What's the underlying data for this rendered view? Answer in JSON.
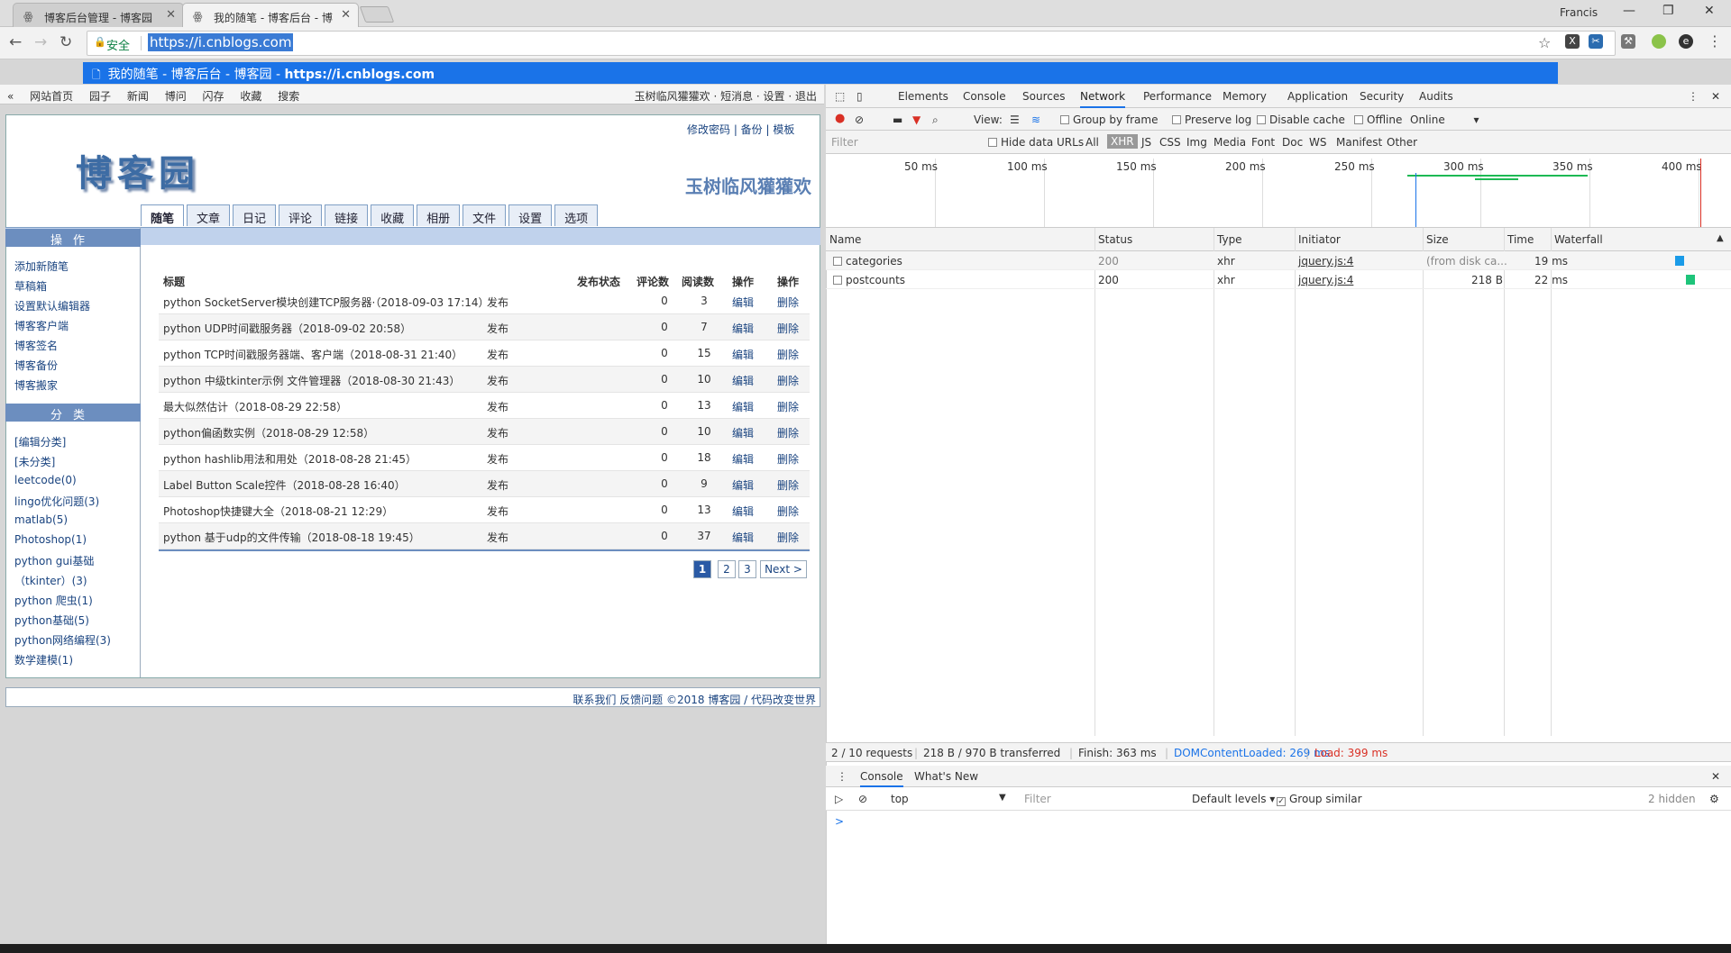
{
  "browser": {
    "tabs": [
      {
        "title": "博客后台管理 - 博客园"
      },
      {
        "title": "我的随笔 - 博客后台 - 博"
      }
    ],
    "user": "Francis",
    "secure_label": "安全",
    "url": "https://i.cnblogs.com",
    "suggestion": {
      "text": "我的随笔 - 博客后台 - 博客园 - ",
      "url": "https://i.cnblogs.com"
    }
  },
  "site": {
    "topnav": [
      "网站首页",
      "园子",
      "新闻",
      "博问",
      "闪存",
      "收藏",
      "搜索"
    ],
    "topnav_right": "玉树临风獾獾欢 · 短消息 · 设置 · 退出",
    "toplinks": "修改密码  |  备份  |  模板",
    "logo": "博客园",
    "blog_name": "玉树临风獾獾欢",
    "tabs": [
      "随笔",
      "文章",
      "日记",
      "评论",
      "链接",
      "收藏",
      "相册",
      "文件",
      "设置",
      "选项"
    ],
    "ops_title": "操作",
    "ops": [
      "添加新随笔",
      "草稿箱",
      "设置默认编辑器",
      "博客客户端",
      "博客签名",
      "博客备份",
      "博客搬家"
    ],
    "cat_title": "分类",
    "categories": [
      "[编辑分类]",
      "[未分类]",
      "leetcode(0)",
      "lingo优化问题(3)",
      "matlab(5)",
      "Photoshop(1)",
      "python gui基础",
      "（tkinter）(3)",
      "python 爬虫(1)",
      "python基础(5)",
      "python网络编程(3)",
      "数学建模(1)"
    ],
    "table": {
      "headers": {
        "title": "标题",
        "status": "发布状态",
        "comments": "评论数",
        "reads": "阅读数",
        "op1": "操作",
        "op2": "操作"
      },
      "rows": [
        {
          "title": "python SocketServer模块创建TCP服务器·（2018-09-03 17:14）",
          "status": "发布",
          "comments": "0",
          "reads": "3",
          "edit": "编辑",
          "del": "删除"
        },
        {
          "title": "python UDP时间戳服务器（2018-09-02 20:58）",
          "status": "发布",
          "comments": "0",
          "reads": "7",
          "edit": "编辑",
          "del": "删除"
        },
        {
          "title": "python TCP时间戳服务器端、客户端（2018-08-31 21:40）",
          "status": "发布",
          "comments": "0",
          "reads": "15",
          "edit": "编辑",
          "del": "删除"
        },
        {
          "title": "python 中级tkinter示例 文件管理器（2018-08-30 21:43）",
          "status": "发布",
          "comments": "0",
          "reads": "10",
          "edit": "编辑",
          "del": "删除"
        },
        {
          "title": "最大似然估计（2018-08-29 22:58）",
          "status": "发布",
          "comments": "0",
          "reads": "13",
          "edit": "编辑",
          "del": "删除"
        },
        {
          "title": "python偏函数实例（2018-08-29 12:58）",
          "status": "发布",
          "comments": "0",
          "reads": "10",
          "edit": "编辑",
          "del": "删除"
        },
        {
          "title": "python hashlib用法和用处（2018-08-28 21:45）",
          "status": "发布",
          "comments": "0",
          "reads": "18",
          "edit": "编辑",
          "del": "删除"
        },
        {
          "title": "Label Button Scale控件（2018-08-28 16:40）",
          "status": "发布",
          "comments": "0",
          "reads": "9",
          "edit": "编辑",
          "del": "删除"
        },
        {
          "title": "Photoshop快捷键大全（2018-08-21 12:29）",
          "status": "发布",
          "comments": "0",
          "reads": "13",
          "edit": "编辑",
          "del": "删除"
        },
        {
          "title": "python 基于udp的文件传输（2018-08-18 19:45）",
          "status": "发布",
          "comments": "0",
          "reads": "37",
          "edit": "编辑",
          "del": "删除"
        }
      ]
    },
    "pager": [
      "1",
      "2",
      "3",
      "Next >"
    ],
    "footer": "联系我们  反馈问题 ©2018 博客园 / 代码改变世界"
  },
  "devtools": {
    "tabs": [
      "Elements",
      "Console",
      "Sources",
      "Network",
      "Performance",
      "Memory",
      "Application",
      "Security",
      "Audits"
    ],
    "net": {
      "view": "View:",
      "group": "Group by frame",
      "preserve": "Preserve log",
      "disable": "Disable cache",
      "offline": "Offline",
      "throttle": "Online"
    },
    "filter": {
      "placeholder": "Filter",
      "hide": "Hide data URLs",
      "types": [
        "All",
        "XHR",
        "JS",
        "CSS",
        "Img",
        "Media",
        "Font",
        "Doc",
        "WS",
        "Manifest",
        "Other"
      ]
    },
    "ticks": [
      "50 ms",
      "100 ms",
      "150 ms",
      "200 ms",
      "250 ms",
      "300 ms",
      "350 ms",
      "400 ms"
    ],
    "cols": [
      "Name",
      "Status",
      "Type",
      "Initiator",
      "Size",
      "Time",
      "Waterfall"
    ],
    "requests": [
      {
        "name": "categories",
        "status": "200",
        "type": "xhr",
        "initiator": "jquery.js:4",
        "size": "(from disk ca...",
        "time": "19 ms"
      },
      {
        "name": "postcounts",
        "status": "200",
        "type": "xhr",
        "initiator": "jquery.js:4",
        "size": "218 B",
        "time": "22 ms"
      }
    ],
    "status": {
      "requests": "2 / 10 requests",
      "transferred": "218 B / 970 B transferred",
      "finish": "Finish: 363 ms",
      "dom": "DOMContentLoaded: 269 ms",
      "load": "Load: 399 ms"
    },
    "drawer": [
      "Console",
      "What's New"
    ],
    "console": {
      "context": "top",
      "filter": "Filter",
      "levels": "Default levels",
      "group": "Group similar",
      "hidden": "2 hidden",
      "prompt": ">"
    },
    "colors": {
      "dom": "#1a73e8",
      "load": "#d93025",
      "accent": "#1a73e8"
    }
  }
}
